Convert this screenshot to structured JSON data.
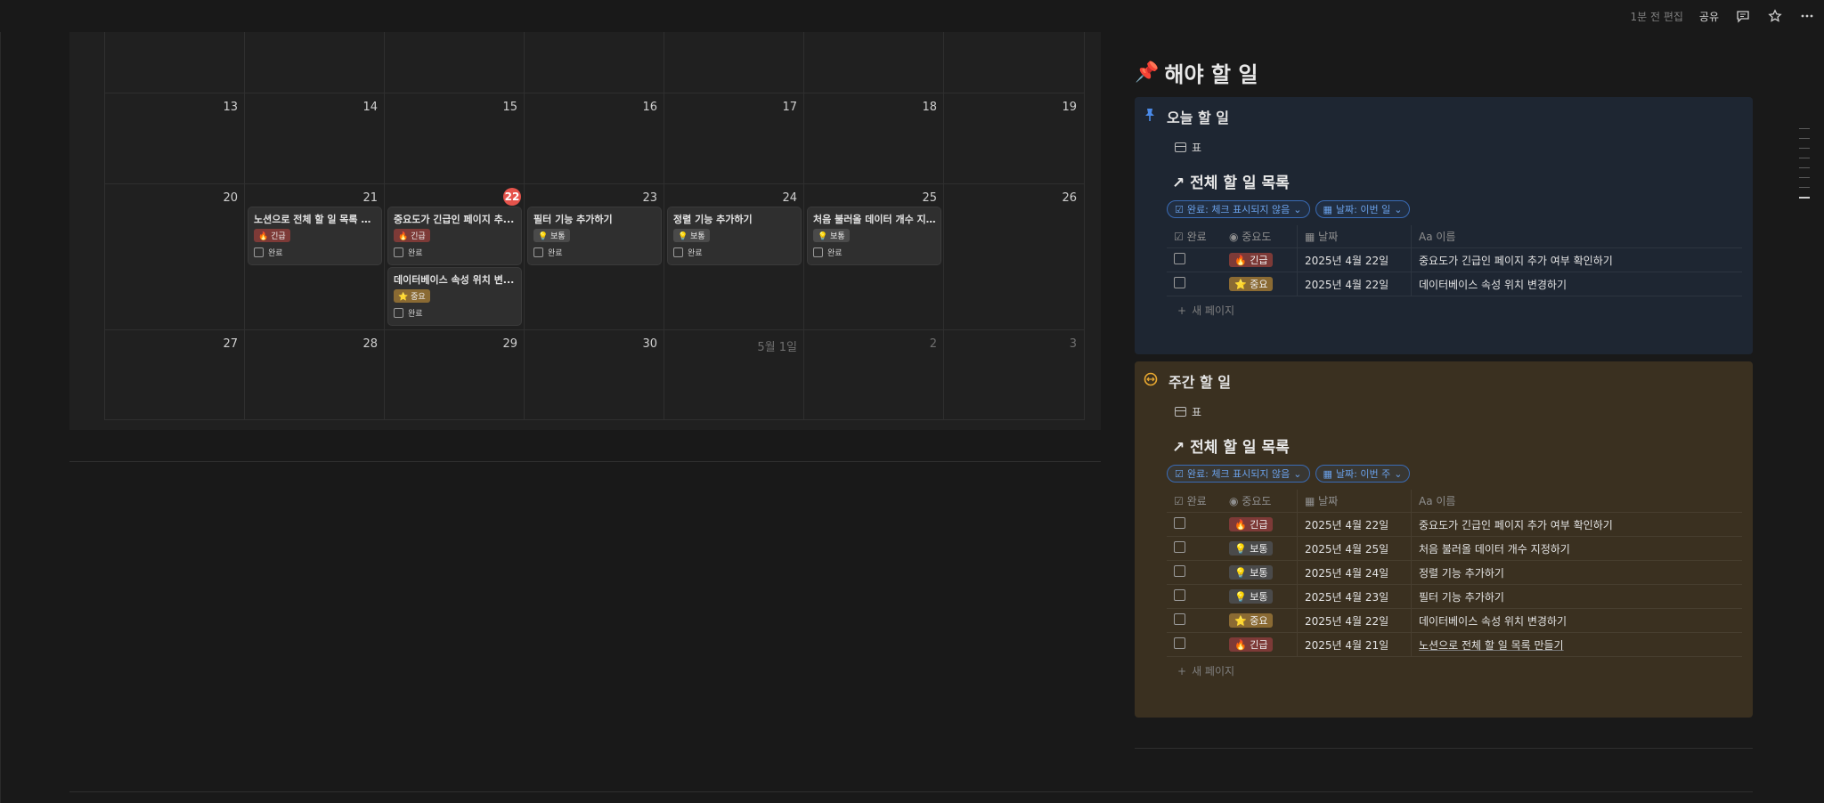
{
  "topbar": {
    "edited": "1분 전 편집",
    "share": "공유"
  },
  "calendar": {
    "weeks": [
      {
        "days": [
          "",
          "",
          "",
          "",
          "",
          "",
          ""
        ]
      },
      {
        "days": [
          "13",
          "14",
          "15",
          "16",
          "17",
          "18",
          "19"
        ]
      },
      {
        "days": [
          "20",
          "21",
          "22",
          "23",
          "24",
          "25",
          "26"
        ]
      },
      {
        "days": [
          "27",
          "28",
          "29",
          "30",
          "5월 1일",
          "2",
          "3"
        ]
      }
    ],
    "today": "22",
    "cards": [
      {
        "title": "노션으로 전체 할 일 목록 만...",
        "tag": "🔥 긴급",
        "done": "완료"
      },
      {
        "title": "중요도가 긴급인 페이지 추...",
        "tag": "🔥 긴급",
        "done": "완료"
      },
      {
        "title": "데이터베이스 속성 위치 변...",
        "tag": "⭐ 중요",
        "done": "완료"
      },
      {
        "title": "필터 기능 추가하기",
        "tag": "💡 보통",
        "done": "완료"
      },
      {
        "title": "정렬 기능 추가하기",
        "tag": "💡 보통",
        "done": "완료"
      },
      {
        "title": "처음 불러올 데이터 개수 지...",
        "tag": "💡 보통",
        "done": "완료"
      }
    ]
  },
  "page": {
    "title": "해야 할 일",
    "today_block": {
      "heading": "오늘 할 일",
      "view": "표",
      "linked_title": "전체 할 일 목록",
      "filters": [
        "완료: 체크 표시되지 않음",
        "날짜: 이번 일"
      ],
      "columns": [
        "완료",
        "중요도",
        "날짜",
        "이름"
      ],
      "rows": [
        {
          "priority": "🔥 긴급",
          "date": "2025년 4월 22일",
          "name": "중요도가 긴급인 페이지 추가 여부 확인하기"
        },
        {
          "priority": "⭐ 중요",
          "date": "2025년 4월 22일",
          "name": "데이터베이스 속성 위치 변경하기"
        }
      ],
      "new_page": "새 페이지"
    },
    "weekly_block": {
      "heading": "주간 할 일",
      "view": "표",
      "linked_title": "전체 할 일 목록",
      "filters": [
        "완료: 체크 표시되지 않음",
        "날짜: 이번 주"
      ],
      "columns": [
        "완료",
        "중요도",
        "날짜",
        "이름"
      ],
      "rows": [
        {
          "priority": "🔥 긴급",
          "date": "2025년 4월 22일",
          "name": "중요도가 긴급인 페이지 추가 여부 확인하기"
        },
        {
          "priority": "💡 보통",
          "date": "2025년 4월 25일",
          "name": "처음 불러올 데이터 개수 지정하기"
        },
        {
          "priority": "💡 보통",
          "date": "2025년 4월 24일",
          "name": "정렬 기능 추가하기"
        },
        {
          "priority": "💡 보통",
          "date": "2025년 4월 23일",
          "name": "필터 기능 추가하기"
        },
        {
          "priority": "⭐ 중요",
          "date": "2025년 4월 22일",
          "name": "데이터베이스 속성 위치 변경하기"
        },
        {
          "priority": "🔥 긴급",
          "date": "2025년 4월 21일",
          "name": "노션으로 전체 할 일 목록 만들기"
        }
      ],
      "new_page": "새 페이지"
    }
  },
  "colors": {
    "urgent": "#7d3a37",
    "important": "#8a6a33",
    "normal": "#4a4a4a",
    "today_bg": "#1e2632",
    "weekly_bg": "#3a3020",
    "accent": "#e5534b"
  }
}
